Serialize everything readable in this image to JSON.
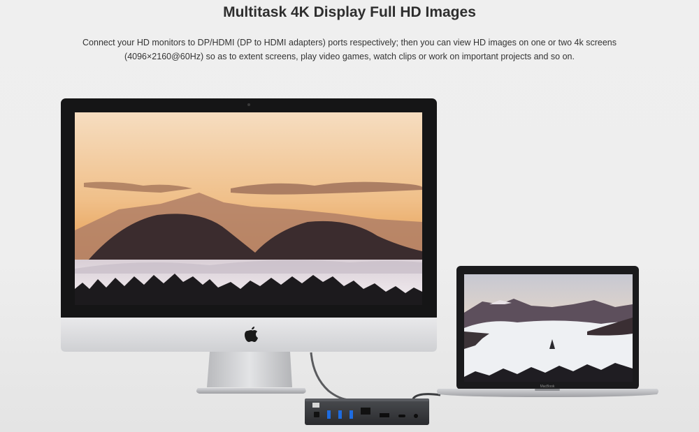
{
  "heading": "Multitask 4K Display Full HD Images",
  "description": {
    "line1": "Connect your HD monitors to DP/HDMI (DP to HDMI adapters) ports respectively; then you can view HD images on one or two 4k screens",
    "line2": "(4096×2160@60Hz) so as to extent screens, play video games, watch clips or work on important projects and so on."
  },
  "laptop_brand": "MacBook",
  "icons": {
    "imac_logo": "apple-logo-icon",
    "ports": [
      "power-port-icon",
      "usb-a-port-icon",
      "ethernet-port-icon",
      "displayport-icon",
      "usb-c-port-icon",
      "audio-jack-icon"
    ]
  }
}
